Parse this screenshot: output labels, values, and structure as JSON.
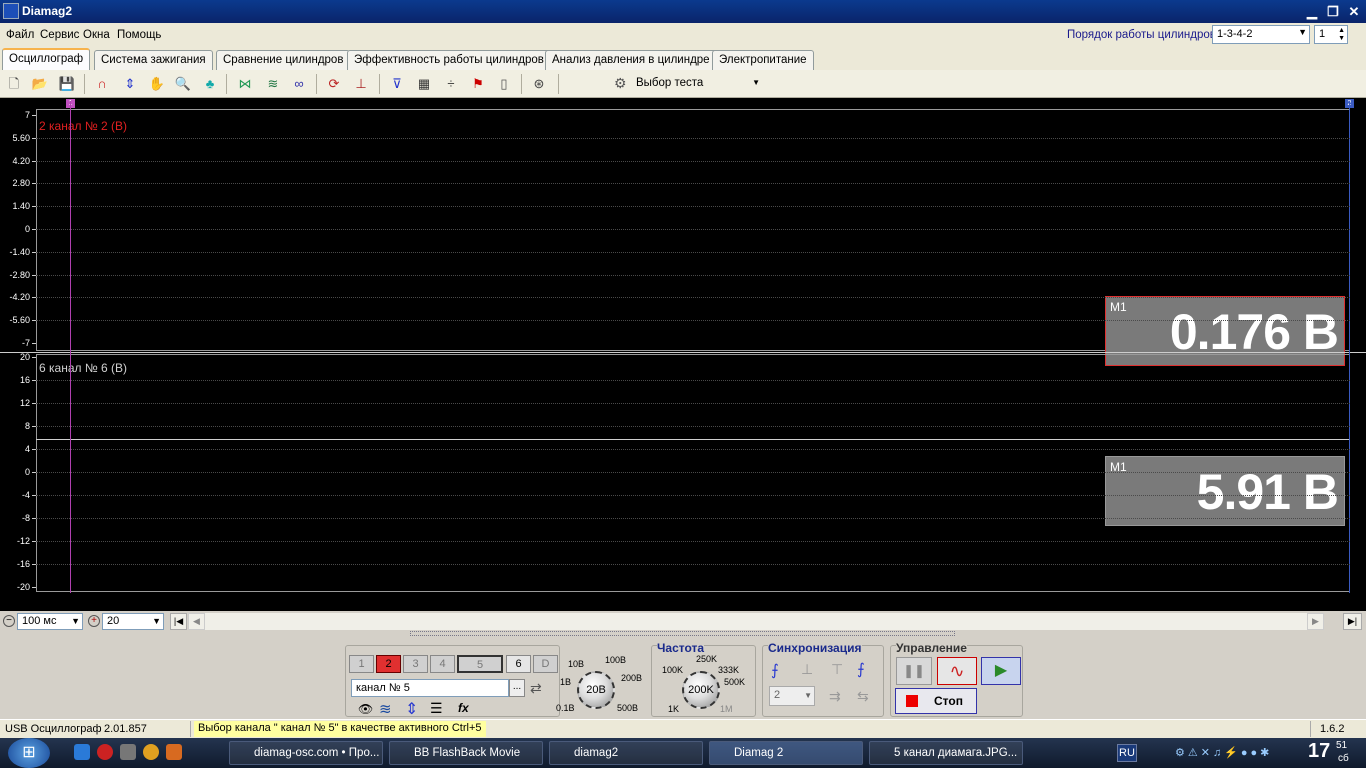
{
  "window": {
    "title": "Diamag2"
  },
  "menu": {
    "items": [
      "Файл",
      "Сервис",
      "Окна",
      "Помощь"
    ]
  },
  "cylinders": {
    "label": "Порядок работы цилиндров",
    "order": "1-3-4-2",
    "number": "1"
  },
  "tabs": [
    "Осциллограф",
    "Система зажигания",
    "Сравнение цилиндров",
    "Эффективность работы цилиндров",
    "Анализ давления в цилиндре",
    "Электропитание"
  ],
  "toolbar": {
    "test_select": "Выбор теста",
    "icons": [
      "new-file-icon",
      "open-folder-icon",
      "save-icon",
      "curve-icon",
      "cursor-measure-icon",
      "hand-pan-icon",
      "zoom-icon",
      "tree-icon",
      "collapse-icon",
      "waves-icon",
      "overlay-icon",
      "auto-icon",
      "zero-icon",
      "filter-icon",
      "grid-icon",
      "split-icon",
      "flag-icon",
      "page-icon",
      "auto-gauge-icon"
    ]
  },
  "scope": {
    "marker_left": "1",
    "marker_right": "2",
    "panel1": {
      "label": "2  канал № 2 (В)",
      "color": "#e02020",
      "ticks": [
        "7",
        "5.60",
        "4.20",
        "2.80",
        "1.40",
        "0",
        "-1.40",
        "-2.80",
        "-4.20",
        "-5.60",
        "-7"
      ],
      "measure_tag": "M1",
      "measure_value": "0.176 В"
    },
    "panel2": {
      "label": "6  канал № 6 (В)",
      "color": "#d0d0d0",
      "ticks": [
        "20",
        "16",
        "12",
        "8",
        "4",
        "0",
        "-4",
        "-8",
        "-12",
        "-16",
        "-20"
      ],
      "measure_tag": "M1",
      "measure_value": "5.91 В"
    }
  },
  "timebar": {
    "timebase": "100 мс",
    "zoom": "20"
  },
  "channels": {
    "buttons": [
      "1",
      "2",
      "3",
      "4",
      "5",
      "6",
      "D"
    ],
    "active_name": "канал № 5",
    "dots": "..."
  },
  "amplitude": {
    "value": "20В",
    "labels": [
      "10В",
      "100В",
      "1В",
      "200В",
      "0.1В",
      "500В"
    ]
  },
  "frequency": {
    "title": "Частота",
    "value": "200K",
    "labels": [
      "250K",
      "100K",
      "333K",
      "500K",
      "1K",
      "1M"
    ]
  },
  "sync": {
    "title": "Синхронизация",
    "channel": "2"
  },
  "control": {
    "title": "Управление",
    "stop_label": "Стоп"
  },
  "status": {
    "device": "USB Осциллограф",
    "version": "2.01.857",
    "message": "Выбор канала \" канал № 5\" в качестве активного Ctrl+5",
    "build": "1.6.2"
  },
  "taskbar": {
    "tasks": [
      "diamag-osc.com • Про...",
      "BB FlashBack Movie",
      "diamag2",
      "Diamag 2",
      "5 канал диамага.JPG..."
    ],
    "active_task": 3,
    "lang": "RU",
    "clock_hour": "17",
    "clock_min": "51",
    "clock_day": "сб"
  }
}
